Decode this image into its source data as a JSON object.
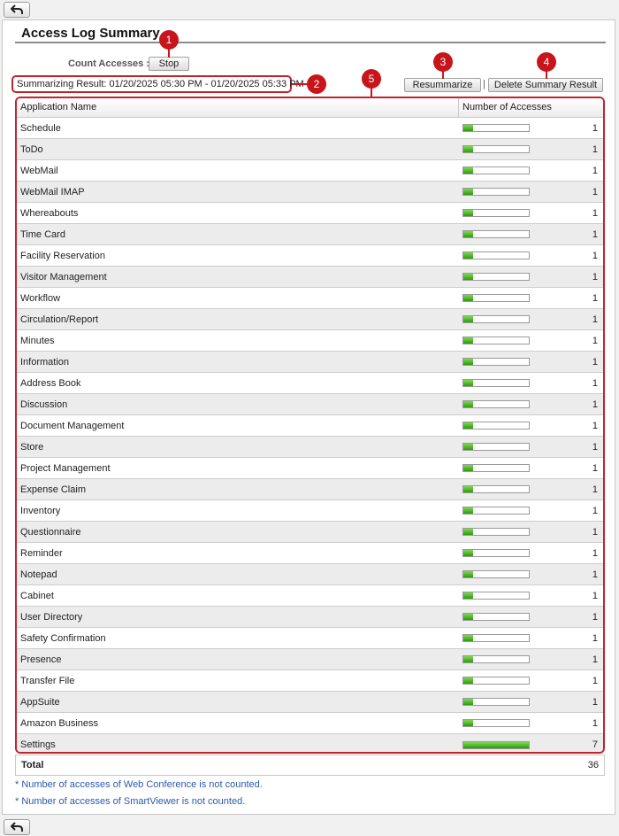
{
  "nav": {
    "back_label": "Back"
  },
  "page": {
    "title": "Access Log Summary",
    "count_accesses_label": "Count Accesses :",
    "stop_label": "Stop",
    "summary_result": "Summarizing Result: 01/20/2025 05:30 PM - 01/20/2025 05:33 PM",
    "resummarize_label": "Resummarize",
    "separator": "|",
    "delete_label": "Delete Summary Result"
  },
  "callouts": [
    "1",
    "2",
    "3",
    "4",
    "5"
  ],
  "table": {
    "headers": [
      "Application Name",
      "Number of Accesses"
    ],
    "max_count": 7,
    "rows": [
      {
        "name": "Schedule",
        "count": 1
      },
      {
        "name": "ToDo",
        "count": 1
      },
      {
        "name": "WebMail",
        "count": 1
      },
      {
        "name": "WebMail IMAP",
        "count": 1
      },
      {
        "name": "Whereabouts",
        "count": 1
      },
      {
        "name": "Time Card",
        "count": 1
      },
      {
        "name": "Facility Reservation",
        "count": 1
      },
      {
        "name": "Visitor Management",
        "count": 1
      },
      {
        "name": "Workflow",
        "count": 1
      },
      {
        "name": "Circulation/Report",
        "count": 1
      },
      {
        "name": "Minutes",
        "count": 1
      },
      {
        "name": "Information",
        "count": 1
      },
      {
        "name": "Address Book",
        "count": 1
      },
      {
        "name": "Discussion",
        "count": 1
      },
      {
        "name": "Document Management",
        "count": 1
      },
      {
        "name": "Store",
        "count": 1
      },
      {
        "name": "Project Management",
        "count": 1
      },
      {
        "name": "Expense Claim",
        "count": 1
      },
      {
        "name": "Inventory",
        "count": 1
      },
      {
        "name": "Questionnaire",
        "count": 1
      },
      {
        "name": "Reminder",
        "count": 1
      },
      {
        "name": "Notepad",
        "count": 1
      },
      {
        "name": "Cabinet",
        "count": 1
      },
      {
        "name": "User Directory",
        "count": 1
      },
      {
        "name": "Safety Confirmation",
        "count": 1
      },
      {
        "name": "Presence",
        "count": 1
      },
      {
        "name": "Transfer File",
        "count": 1
      },
      {
        "name": "AppSuite",
        "count": 1
      },
      {
        "name": "Amazon Business",
        "count": 1
      },
      {
        "name": "Settings",
        "count": 7
      }
    ],
    "total_label": "Total",
    "total_value": "36"
  },
  "notes": [
    "* Number of accesses of Web Conference is not counted.",
    "* Number of accesses of SmartViewer is not counted."
  ],
  "colors": {
    "callout_red": "#c8151b",
    "bar_green": "#2f9a0c",
    "note_blue": "#2a5ab0"
  }
}
